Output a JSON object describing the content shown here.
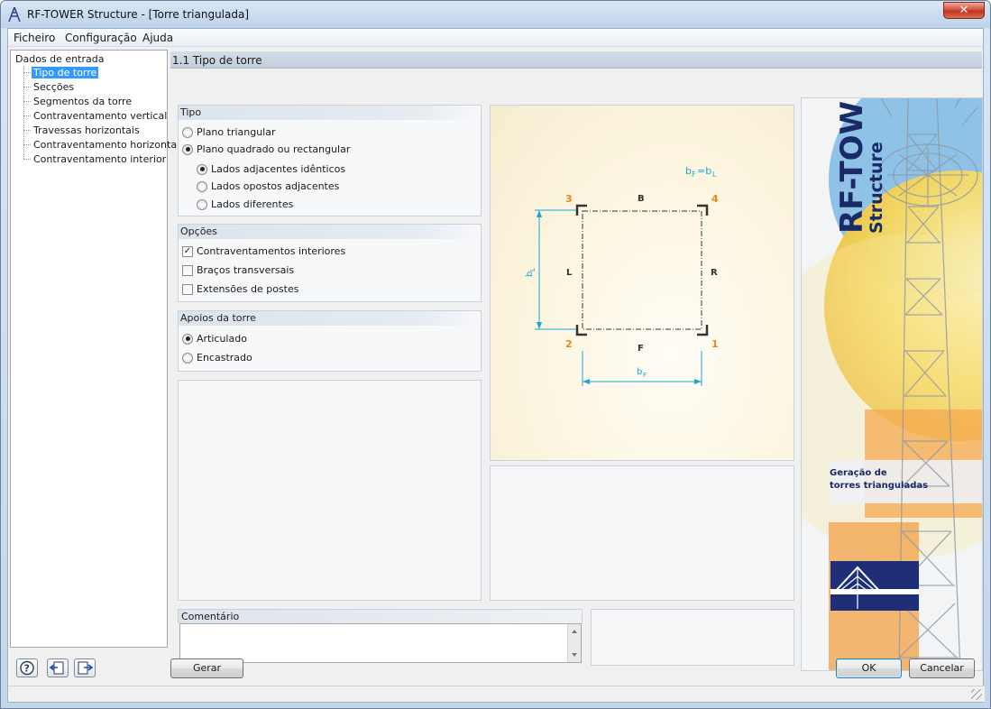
{
  "window": {
    "title": "RF-TOWER Structure - [Torre triangulada]",
    "close_glyph": "✕"
  },
  "menu": [
    "Ficheiro",
    "Configuração",
    "Ajuda"
  ],
  "nav": {
    "root": "Dados de entrada",
    "items": [
      {
        "label": "Tipo de torre",
        "selected": true
      },
      {
        "label": "Secções"
      },
      {
        "label": "Segmentos da torre"
      },
      {
        "label": "Contraventamento vertical"
      },
      {
        "label": "Travessas horizontais"
      },
      {
        "label": "Contraventamento horizontal"
      },
      {
        "label": "Contraventamento interior"
      }
    ]
  },
  "section_title": "1.1 Tipo de torre",
  "groups": {
    "tipo": {
      "title": "Tipo",
      "options": [
        "Plano triangular",
        "Plano quadrado ou rectangular"
      ],
      "selected": "Plano quadrado ou rectangular",
      "sub_options": [
        "Lados adjacentes idênticos",
        "Lados opostos adjacentes",
        "Lados diferentes"
      ],
      "sub_selected": "Lados adjacentes idênticos"
    },
    "opcoes": {
      "title": "Opções",
      "checks": [
        {
          "label": "Contraventamentos interiores",
          "checked": true
        },
        {
          "label": "Braços transversais",
          "checked": false
        },
        {
          "label": "Extensões de postes",
          "checked": false
        }
      ],
      "check_glyph": "✓"
    },
    "apoios": {
      "title": "Apoios da torre",
      "options": [
        "Articulado",
        "Encastrado"
      ],
      "selected": "Articulado"
    }
  },
  "diagram": {
    "formula_main": "b",
    "formula_sub_f": "F",
    "formula_eq": "=b",
    "formula_sub_l": "L",
    "corner_3": "3",
    "corner_4": "4",
    "corner_2": "2",
    "corner_1": "1",
    "side_top": "B",
    "side_bottom": "F",
    "side_left": "L",
    "side_right": "R",
    "dim_left_main": "b",
    "dim_left_sub": "L",
    "dim_bottom_main": "b",
    "dim_bottom_sub": "F",
    "colors": {
      "corner": "#e8871e",
      "dimension": "#1aa6d8",
      "accent": "#3399ff"
    }
  },
  "brand": {
    "title": "RF-TOWER",
    "subtitle": "Structure",
    "tagline_line1": "Geração de",
    "tagline_line2": "torres trianguladas"
  },
  "comment": {
    "label": "Comentário",
    "value": ""
  },
  "buttons": {
    "generate": "Gerar",
    "ok": "OK",
    "cancel": "Cancelar"
  },
  "icons": [
    "help-icon",
    "import-icon",
    "export-icon"
  ]
}
